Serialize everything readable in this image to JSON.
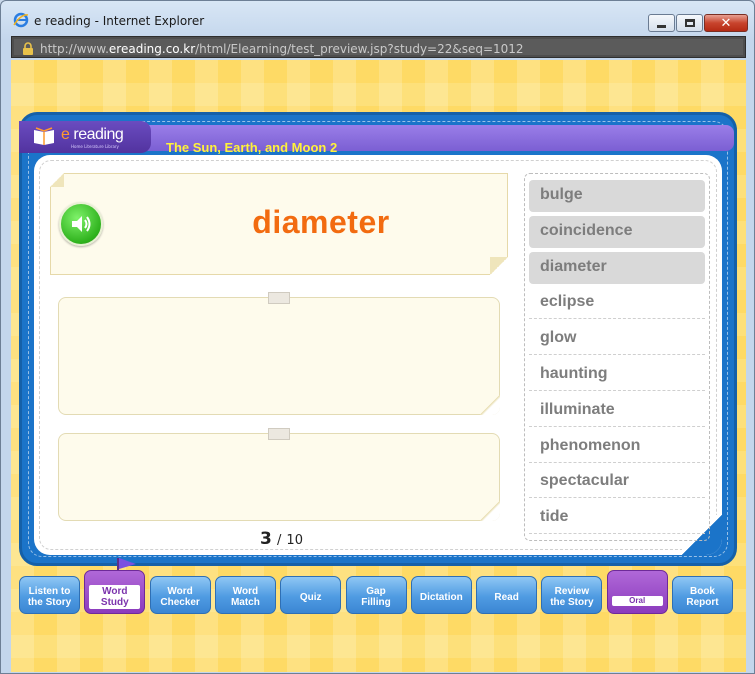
{
  "window": {
    "title": "e reading - Internet Explorer",
    "url_prefix": "http://www.",
    "url_domain": "ereading.co.kr",
    "url_path": "/html/Elearning/test_preview.jsp?study=22&seq=1012",
    "close_label": "✕"
  },
  "app": {
    "logo_text": "reading",
    "logo_e": "e",
    "logo_sub": "Home Literature Library",
    "lesson_title": "The Sun, Earth, and Moon 2"
  },
  "word_card": {
    "word": "diameter"
  },
  "pager": {
    "current": "3",
    "separator": "/",
    "total": "10"
  },
  "word_list": [
    {
      "label": "bulge",
      "done": true
    },
    {
      "label": "coincidence",
      "done": true
    },
    {
      "label": "diameter",
      "done": true
    },
    {
      "label": "eclipse",
      "done": false
    },
    {
      "label": "glow",
      "done": false
    },
    {
      "label": "haunting",
      "done": false
    },
    {
      "label": "illuminate",
      "done": false
    },
    {
      "label": "phenomenon",
      "done": false
    },
    {
      "label": "spectacular",
      "done": false
    },
    {
      "label": "tide",
      "done": false
    }
  ],
  "tabs": [
    {
      "line1": "Listen to",
      "line2": "the Story"
    },
    {
      "line1": "Word",
      "line2": "Study"
    },
    {
      "line1": "Word",
      "line2": "Checker"
    },
    {
      "line1": "Word",
      "line2": "Match"
    },
    {
      "line1": "Quiz",
      "line2": ""
    },
    {
      "line1": "Gap",
      "line2": "Filling"
    },
    {
      "line1": "Dictation",
      "line2": ""
    },
    {
      "line1": "Read",
      "line2": ""
    },
    {
      "line1": "Review",
      "line2": "the Story"
    },
    {
      "line1": "Oral",
      "line2": "Summary"
    },
    {
      "line1": "Book",
      "line2": "Report"
    }
  ],
  "colors": {
    "accent_word": "#f26b10",
    "board_blue": "#1b74c9",
    "header_purple": "#7b5fd3",
    "active_tab": "#8b3bbd",
    "title_yellow": "#fff23a"
  }
}
